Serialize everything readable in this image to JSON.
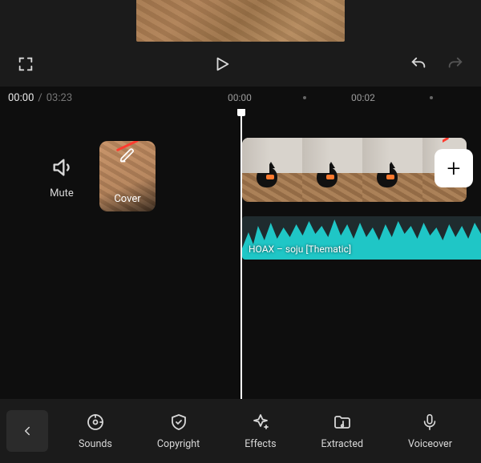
{
  "time": {
    "current": "00:00",
    "separator": "/",
    "total": "03:23"
  },
  "ruler": {
    "marks": [
      "00:00",
      "00:02"
    ]
  },
  "pre": {
    "mute": "Mute",
    "cover": "Cover"
  },
  "audio": {
    "label": "HOAX – soju [Thematic]"
  },
  "add": {
    "glyph": "+"
  },
  "toolbar": {
    "sounds": "Sounds",
    "copyright": "Copyright",
    "effects": "Effects",
    "extracted": "Extracted",
    "voiceover": "Voiceover"
  }
}
